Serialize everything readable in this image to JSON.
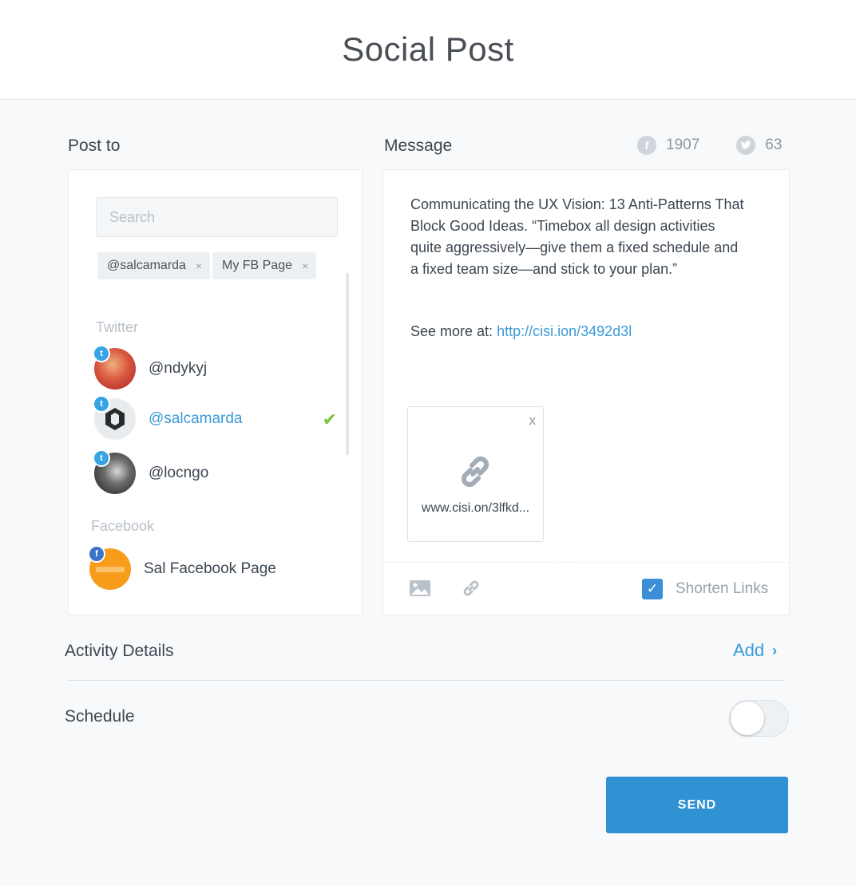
{
  "header": {
    "title": "Social Post"
  },
  "post_to": {
    "label": "Post to",
    "search_placeholder": "Search",
    "tags": [
      {
        "label": "@salcamarda",
        "remove": "×"
      },
      {
        "label": "My FB Page",
        "remove": "×"
      }
    ],
    "groups": [
      {
        "label": "Twitter",
        "accounts": [
          {
            "name": "@ndykyj",
            "selected": false
          },
          {
            "name": "@salcamarda",
            "selected": true
          },
          {
            "name": "@locngo",
            "selected": false
          }
        ]
      },
      {
        "label": "Facebook",
        "accounts": [
          {
            "name": "Sal Facebook Page",
            "selected": false
          }
        ]
      }
    ],
    "check_mark": "✔"
  },
  "message": {
    "label": "Message",
    "facebook_count": "1907",
    "twitter_count": "63",
    "body": "Communicating the UX Vision: 13 Anti-Patterns That Block Good Ideas. “Timebox all design activities quite aggressively—give them a fixed schedule and a fixed team size—and stick to your plan.”",
    "see_more_label": "See more at:",
    "see_more_link": "http://cisi.ion/3492d3l",
    "attachment": {
      "url": "www.cisi.on/3lfkd...",
      "close": "x"
    },
    "shorten_links": {
      "label": "Shorten Links",
      "checked": true
    }
  },
  "activity_details": {
    "label": "Activity Details",
    "add_label": "Add"
  },
  "schedule": {
    "label": "Schedule",
    "enabled": false
  },
  "send_label": "SEND",
  "colors": {
    "accent": "#2f92d3",
    "link": "#3a9ad9",
    "twitter_badge": "#36a3e3",
    "facebook_badge": "#3b73c8",
    "check": "#7cc243",
    "background": "#f7f9fb"
  }
}
